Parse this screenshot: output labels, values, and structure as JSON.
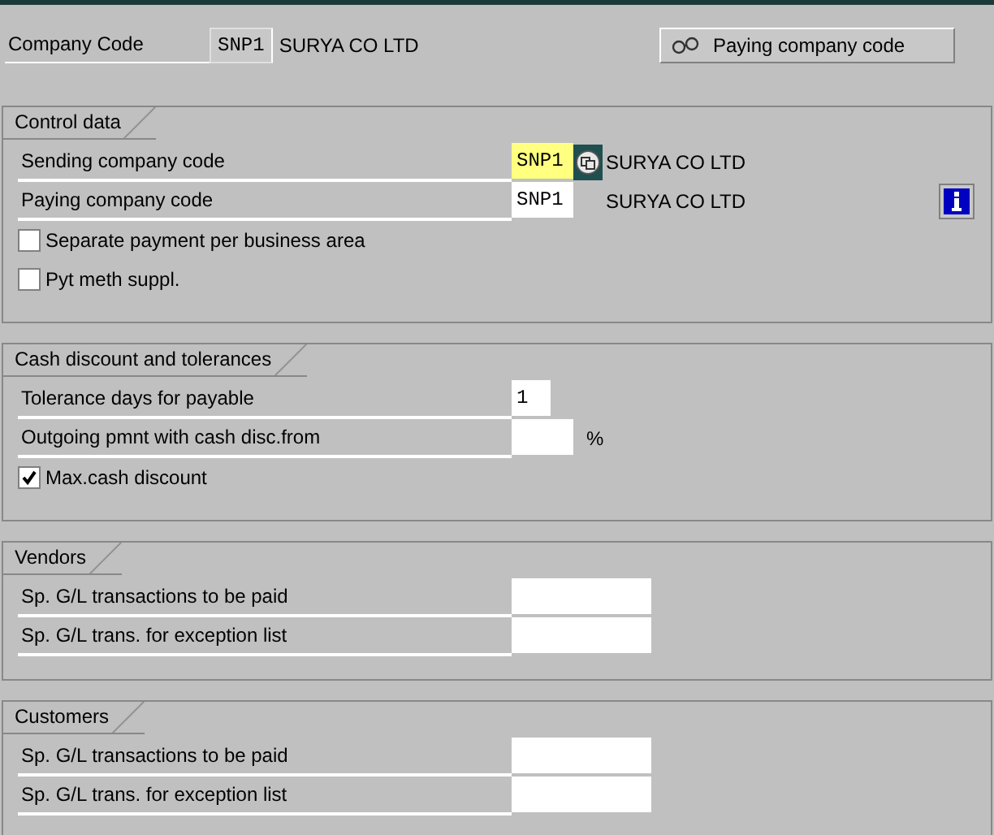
{
  "header": {
    "label": "Company Code",
    "code": "SNP1",
    "name": "SURYA CO LTD",
    "button": "Paying company code"
  },
  "groups": [
    {
      "title": "Control data",
      "rows": [
        {
          "kind": "code-field",
          "label": "Sending company code",
          "value": "SNP1",
          "highlighted": true,
          "search_help": true,
          "description": "SURYA CO LTD"
        },
        {
          "kind": "code-field",
          "label": "Paying company code",
          "value": "SNP1",
          "highlighted": false,
          "description": "SURYA CO LTD",
          "info": true
        },
        {
          "kind": "checkbox",
          "label": "Separate payment per business area",
          "checked": false
        },
        {
          "kind": "checkbox",
          "label": "Pyt meth suppl.",
          "checked": false
        }
      ]
    },
    {
      "title": "Cash discount and tolerances",
      "rows": [
        {
          "kind": "number-field",
          "label": "Tolerance days for payable",
          "value": "1"
        },
        {
          "kind": "percent-field",
          "label": "Outgoing pmnt with cash disc.from",
          "unit": "%"
        },
        {
          "kind": "checkbox",
          "label": "Max.cash discount",
          "checked": true
        }
      ]
    },
    {
      "title": "Vendors",
      "rows": [
        {
          "kind": "text-field",
          "label": "Sp. G/L transactions to be paid"
        },
        {
          "kind": "text-field",
          "label": "Sp. G/L trans. for exception list"
        }
      ]
    },
    {
      "title": "Customers",
      "rows": [
        {
          "kind": "text-field",
          "label": "Sp. G/L transactions to be paid"
        },
        {
          "kind": "text-field",
          "label": "Sp. G/L trans. for exception list"
        }
      ]
    }
  ]
}
